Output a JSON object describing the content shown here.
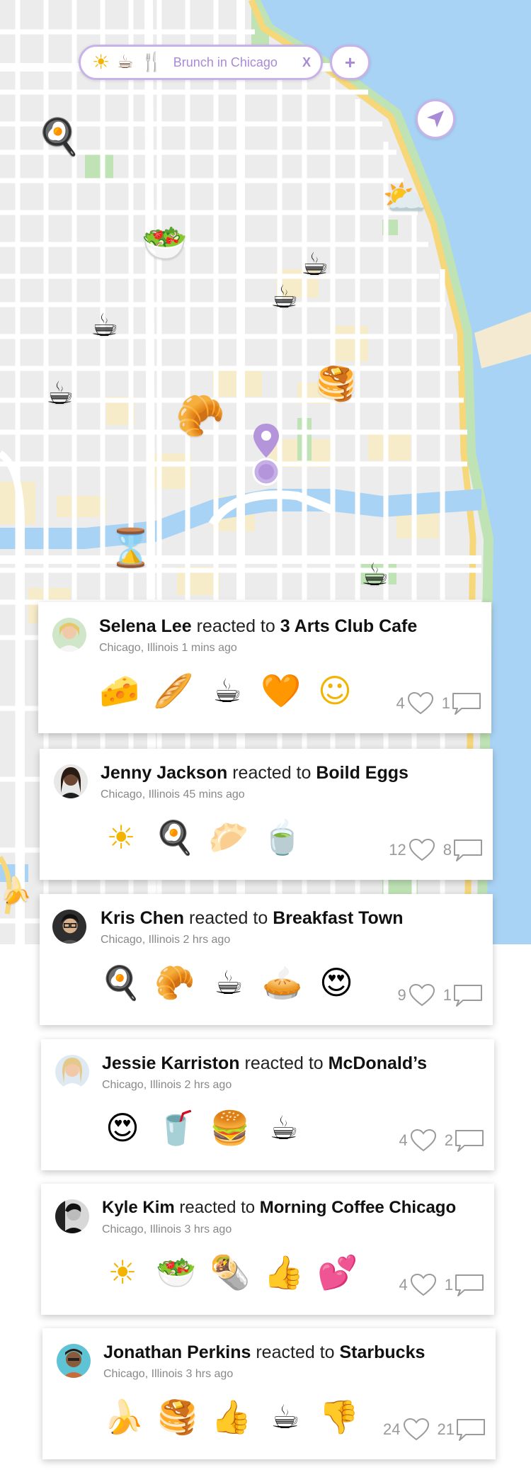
{
  "search": {
    "label": "Brunch in Chicago",
    "close": "X",
    "icons": [
      "sun-icon",
      "coffee-cup-icon",
      "fork-knife-icon"
    ]
  },
  "add_button": {
    "label": "+"
  },
  "map": {
    "markers": [
      {
        "name": "frying-egg-marker",
        "glyph": "🍳"
      },
      {
        "name": "salad-marker",
        "glyph": "🥗"
      },
      {
        "name": "coffee-marker",
        "glyph": "☕"
      },
      {
        "name": "pancakes-marker",
        "glyph": "🥞"
      },
      {
        "name": "croissant-marker",
        "glyph": "🥐"
      },
      {
        "name": "hourglass-marker",
        "glyph": "⌛"
      },
      {
        "name": "sun-behind-cloud-marker",
        "glyph": "⛅"
      }
    ]
  },
  "posts": [
    {
      "user": "Selena Lee",
      "verb": "reacted to",
      "place": "3 Arts Club Cafe",
      "location": "Chicago, Illinois",
      "time": "1 mins ago",
      "reactions": [
        "🧀",
        "🥖",
        "☕",
        "🧡",
        "☺"
      ],
      "reaction_names": [
        "cheese-icon",
        "baguette-icon",
        "coffee-icon",
        "orange-heart-icon",
        "smiling-face-icon"
      ],
      "likes": "4",
      "comments": "1"
    },
    {
      "user": "Jenny Jackson",
      "verb": "reacted to",
      "place": "Boild Eggs",
      "location": "Chicago, Illinois",
      "time": "45 mins ago",
      "reactions": [
        "☀",
        "🍳",
        "🥟",
        "🍵"
      ],
      "reaction_names": [
        "sun-icon",
        "frying-egg-icon",
        "dumpling-icon",
        "green-tea-icon"
      ],
      "likes": "12",
      "comments": "8"
    },
    {
      "user": "Kris Chen",
      "verb": "reacted to",
      "place": "Breakfast Town",
      "location": "Chicago, Illinois",
      "time": "2 hrs ago",
      "reactions": [
        "🍳",
        "🥐",
        "☕",
        "🥧",
        "😍"
      ],
      "reaction_names": [
        "frying-egg-icon",
        "croissant-icon",
        "coffee-icon",
        "pie-icon",
        "heart-eyes-icon"
      ],
      "likes": "9",
      "comments": "1"
    },
    {
      "user": "Jessie Karriston",
      "verb": "reacted to",
      "place": "McDonald’s",
      "location": "Chicago, Illinois",
      "time": "2 hrs ago",
      "reactions": [
        "😍",
        "🥤",
        "🍔",
        "☕"
      ],
      "reaction_names": [
        "heart-eyes-icon",
        "soda-cup-icon",
        "burger-icon",
        "coffee-icon"
      ],
      "likes": "4",
      "comments": "2"
    },
    {
      "user": "Kyle Kim",
      "verb": "reacted to",
      "place": "Morning Coffee Chicago",
      "location": "Chicago, Illinois",
      "time": "3 hrs ago",
      "reactions": [
        "☀",
        "🥗",
        "🌯",
        "👍",
        "💕"
      ],
      "reaction_names": [
        "sun-icon",
        "salad-icon",
        "burrito-icon",
        "thumbs-up-icon",
        "two-hearts-icon"
      ],
      "likes": "4",
      "comments": "1"
    },
    {
      "user": "Jonathan Perkins",
      "verb": "reacted to",
      "place": "Starbucks",
      "location": "Chicago, Illinois",
      "time": "3 hrs ago",
      "reactions": [
        "🍌",
        "🥞",
        "👍",
        "☕",
        "👎"
      ],
      "reaction_names": [
        "banana-icon",
        "pancakes-icon",
        "thumbs-up-icon",
        "coffee-icon",
        "thumbs-down-icon"
      ],
      "likes": "24",
      "comments": "21"
    }
  ],
  "colors": {
    "accent": "#a98ad6",
    "accent_border": "#c8b2e8",
    "water": "#a9d3f5",
    "park": "#b8e0b0",
    "block_yellow": "#f8ebc8",
    "highway": "#f6d77a"
  }
}
